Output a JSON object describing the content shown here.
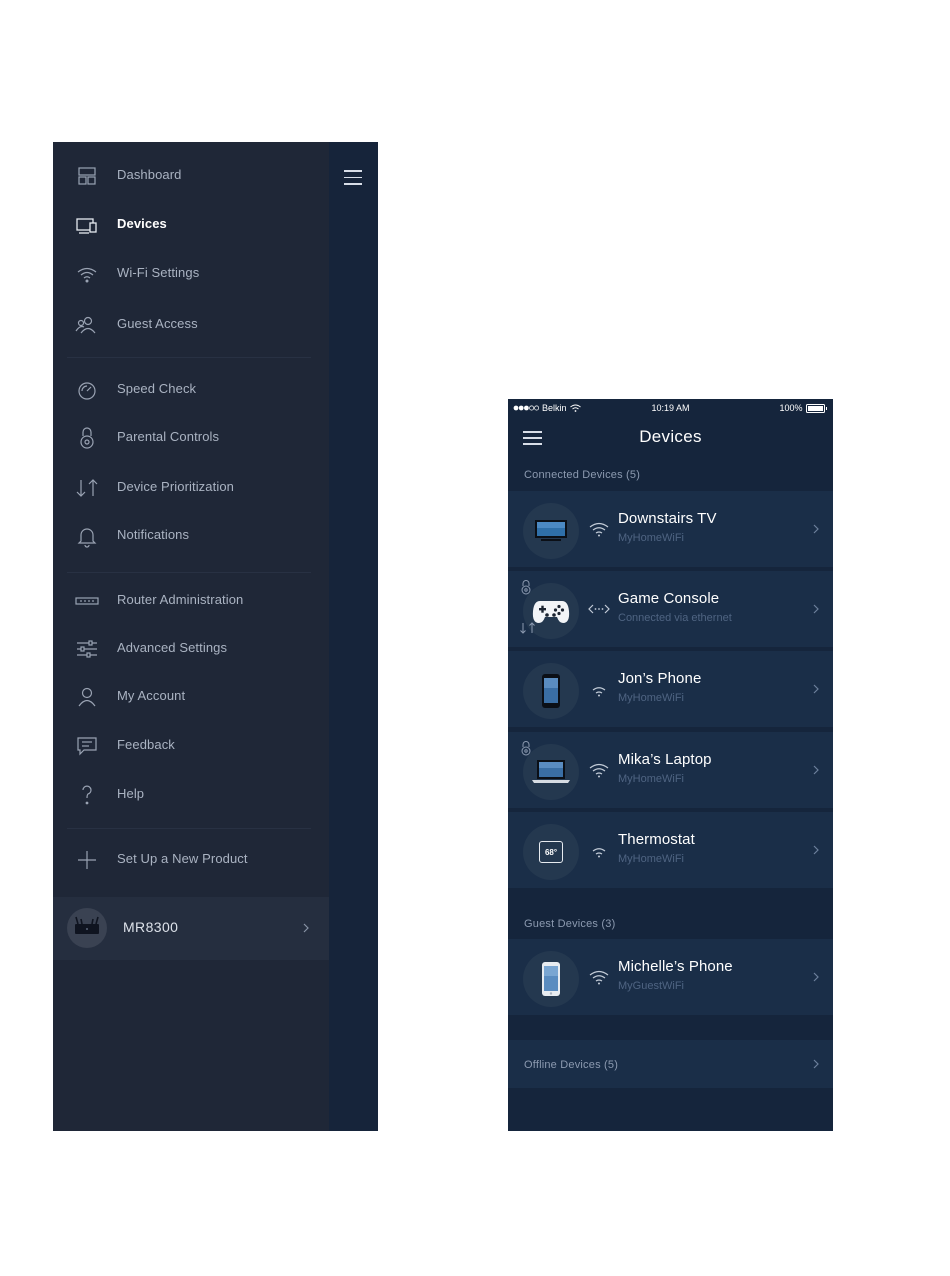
{
  "menu": {
    "items": [
      {
        "label": "Dashboard",
        "icon": "dashboard-icon",
        "active": false
      },
      {
        "label": "Devices",
        "icon": "devices-icon",
        "active": true
      },
      {
        "label": "Wi-Fi Settings",
        "icon": "wifi-icon",
        "active": false
      },
      {
        "label": "Guest Access",
        "icon": "guest-access-icon",
        "active": false
      },
      {
        "label": "Speed Check",
        "icon": "speed-check-icon",
        "active": false
      },
      {
        "label": "Parental Controls",
        "icon": "parental-controls-icon",
        "active": false
      },
      {
        "label": "Device Prioritization",
        "icon": "device-prioritization-icon",
        "active": false
      },
      {
        "label": "Notifications",
        "icon": "bell-icon",
        "active": false
      },
      {
        "label": "Router Administration",
        "icon": "router-icon",
        "active": false
      },
      {
        "label": "Advanced Settings",
        "icon": "sliders-icon",
        "active": false
      },
      {
        "label": "My Account",
        "icon": "account-icon",
        "active": false
      },
      {
        "label": "Feedback",
        "icon": "feedback-icon",
        "active": false
      },
      {
        "label": "Help",
        "icon": "help-icon",
        "active": false
      },
      {
        "label": "Set Up a New Product",
        "icon": "plus-icon",
        "active": false
      }
    ],
    "router": {
      "name": "MR8300"
    }
  },
  "phone": {
    "status_bar": {
      "carrier": "Belkin",
      "time": "10:19 AM",
      "battery": "100%"
    },
    "title": "Devices",
    "connected_label": "Connected Devices (5)",
    "connected": [
      {
        "name": "Downstairs TV",
        "sub": "MyHomeWiFi",
        "icon": "tv-icon",
        "conn": "wifi-icon"
      },
      {
        "name": "Game Console",
        "sub": "Connected via ethernet",
        "icon": "gamepad-icon",
        "conn": "ethernet-icon"
      },
      {
        "name": "Jon’s Phone",
        "sub": "MyHomeWiFi",
        "icon": "phone-icon",
        "conn": "wifi-icon"
      },
      {
        "name": "Mika’s Laptop",
        "sub": "MyHomeWiFi",
        "icon": "laptop-icon",
        "conn": "wifi-icon"
      },
      {
        "name": "Thermostat",
        "sub": "MyHomeWiFi",
        "icon": "thermostat-icon",
        "conn": "wifi-icon",
        "display": "68°"
      }
    ],
    "guest_label": "Guest Devices (3)",
    "guest": [
      {
        "name": "Michelle’s Phone",
        "sub": "MyGuestWiFi",
        "icon": "phone-icon",
        "conn": "wifi-icon"
      }
    ],
    "offline_label": "Offline Devices (5)"
  },
  "colors": {
    "menu_bg": "#1f2737",
    "phone_bg": "#15253c",
    "row_bg": "#1a2e48",
    "muted_text": "#8c9ab0"
  }
}
